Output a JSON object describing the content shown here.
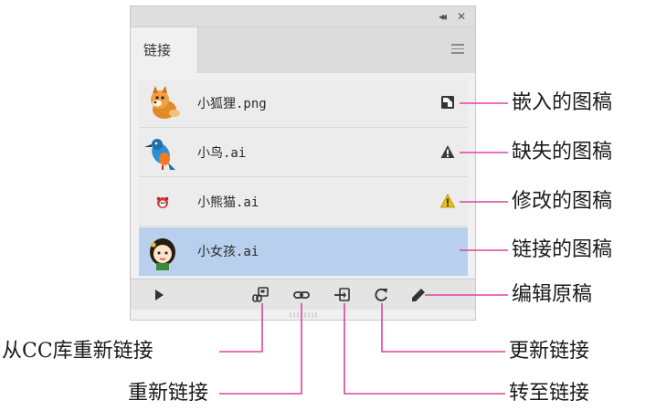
{
  "panel": {
    "tab_label": "链接",
    "links": [
      {
        "name": "小狐狸.png",
        "status": "embedded",
        "thumb": "fox-icon"
      },
      {
        "name": "小鸟.ai",
        "status": "missing",
        "thumb": "bird-icon"
      },
      {
        "name": "小熊猫.ai",
        "status": "modified",
        "thumb": "panda-icon"
      },
      {
        "name": "小女孩.ai",
        "status": "linked",
        "thumb": "girl-icon"
      }
    ],
    "toolbar_icons": [
      "expand-triangle-icon",
      "relink-cc-library-icon",
      "relink-icon",
      "goto-link-icon",
      "update-link-icon",
      "edit-original-icon"
    ]
  },
  "callouts": {
    "embedded": "嵌入的图稿",
    "missing": "缺失的图稿",
    "modified": "修改的图稿",
    "linked": "链接的图稿",
    "edit_original": "编辑原稿",
    "relink_cc": "从CC库重新链接",
    "relink": "重新链接",
    "update_link": "更新链接",
    "goto_link": "转至链接"
  },
  "colors": {
    "leader_line": "#e0449a",
    "selected_row": "#b8d0ee",
    "warning": "#e8b400"
  }
}
